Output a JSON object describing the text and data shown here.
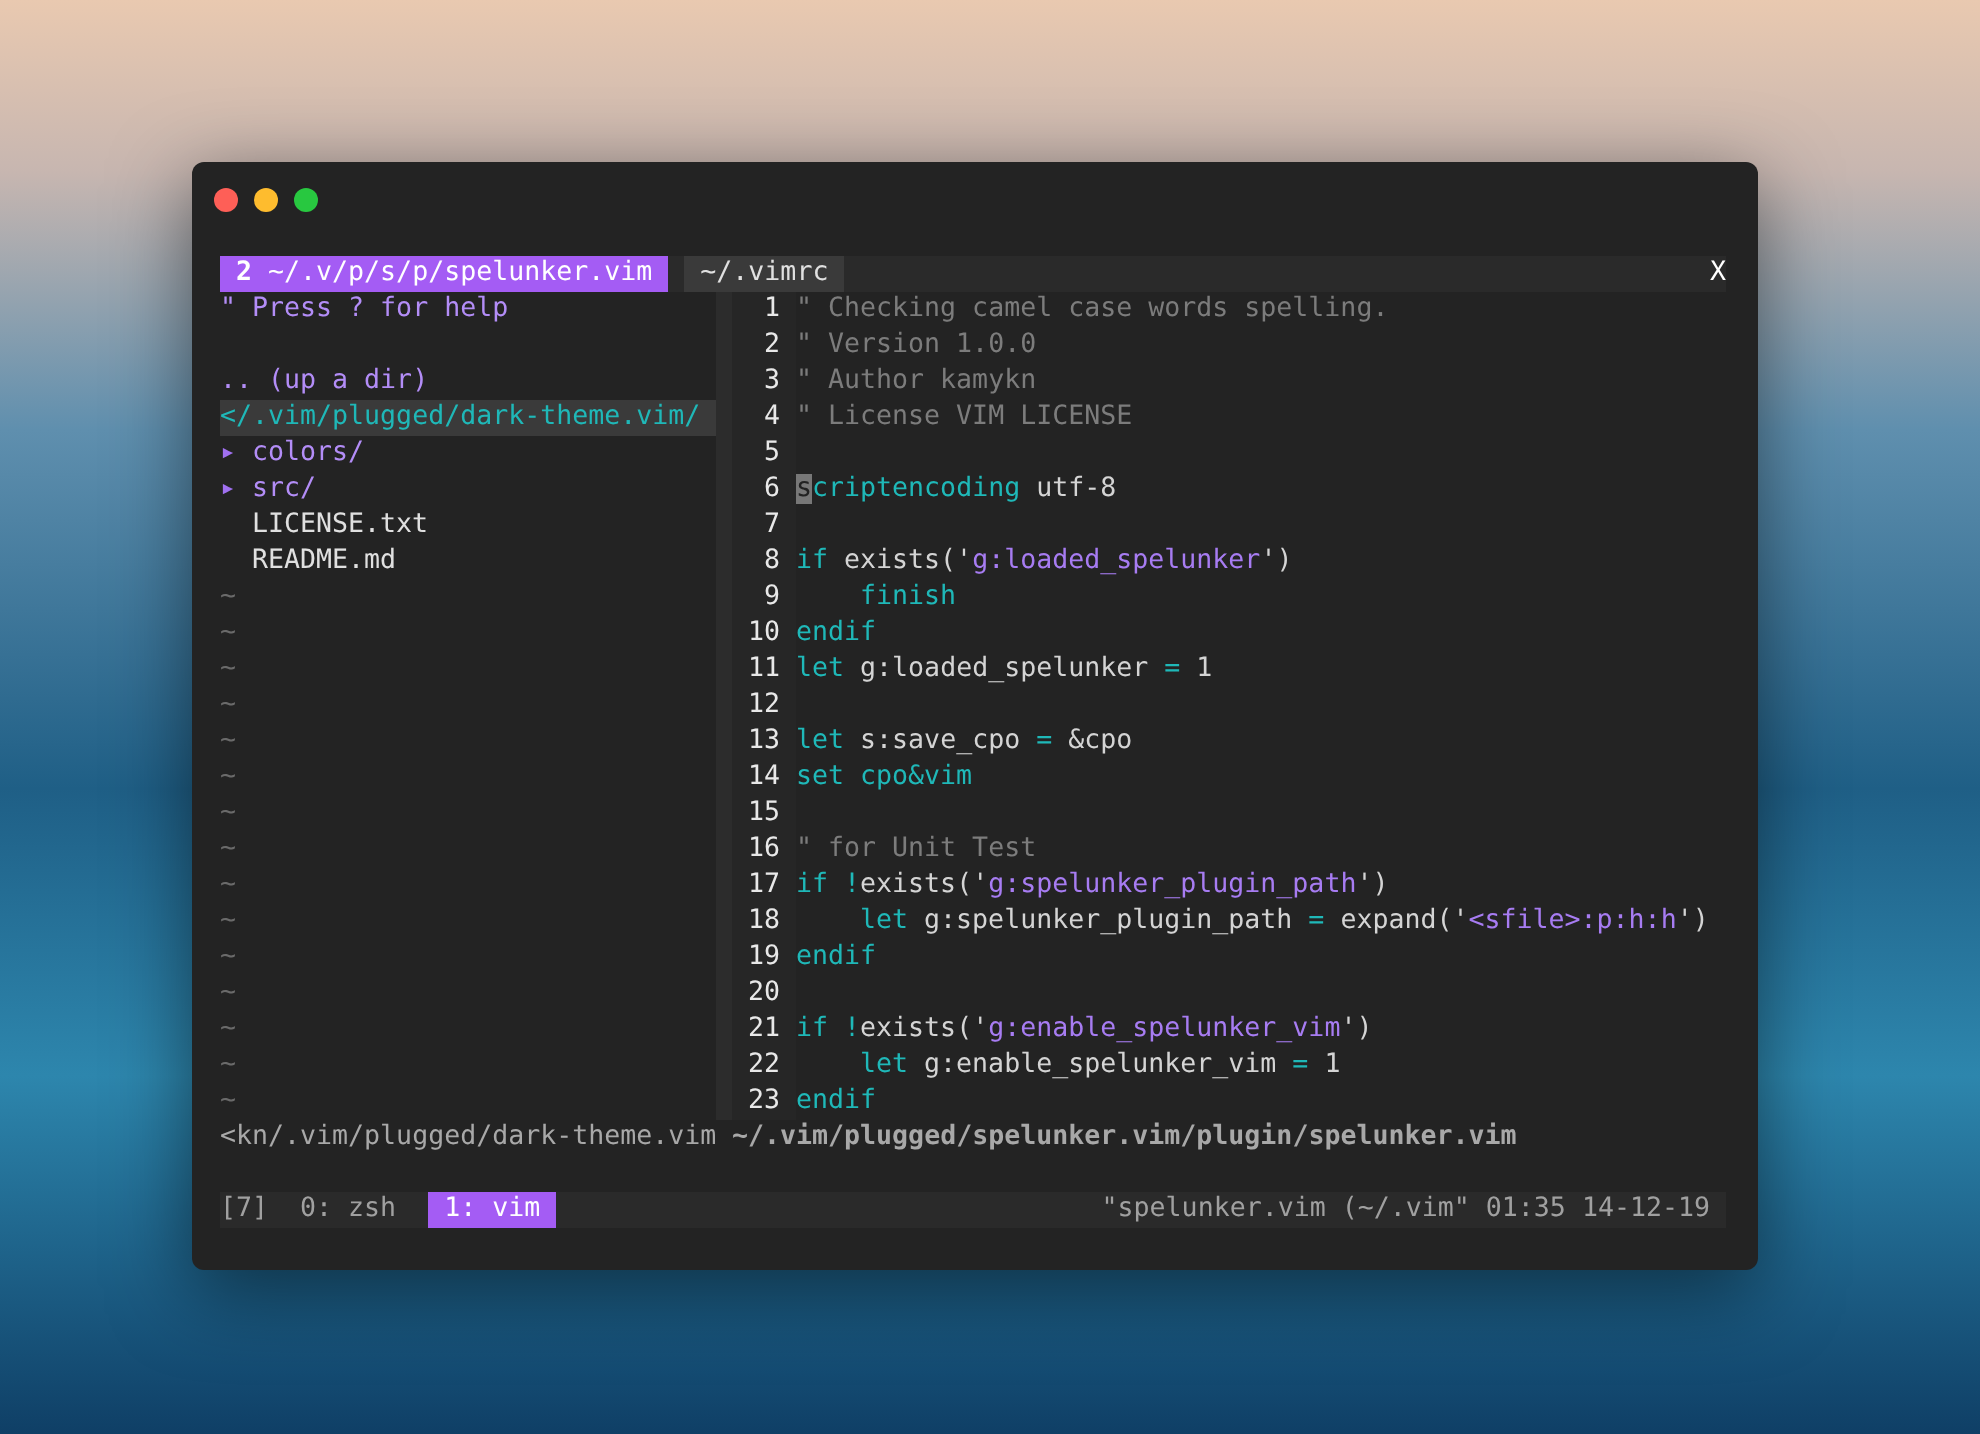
{
  "tabline": {
    "tabs": [
      {
        "count": "2",
        "label": "~/.v/p/s/p/spelunker.vim",
        "selected": true
      },
      {
        "label": "~/.vimrc",
        "selected": false
      }
    ],
    "close": "X"
  },
  "tree": {
    "help": "\" Press ? for help",
    "items": [
      {
        "kind": "up",
        "label": ".. (up a dir)",
        "selected": false
      },
      {
        "kind": "root",
        "label": "</.vim/plugged/dark-theme.vim/",
        "selected": true
      },
      {
        "kind": "dir",
        "marker": "▸",
        "label": "colors/",
        "selected": false
      },
      {
        "kind": "dir",
        "marker": "▸",
        "label": "src/",
        "selected": false
      },
      {
        "kind": "file",
        "label": "LICENSE.txt",
        "selected": false
      },
      {
        "kind": "file",
        "label": "README.md",
        "selected": false
      }
    ],
    "filler": [
      "~",
      "~",
      "~",
      "~",
      "~",
      "~",
      "~",
      "~",
      "~",
      "~",
      "~",
      "~",
      "~",
      "~",
      "~"
    ]
  },
  "editor": {
    "lines": [
      {
        "number": "1",
        "tokens": [
          {
            "kind": "comment",
            "text": "\" Checking camel case words spelling."
          }
        ]
      },
      {
        "number": "2",
        "tokens": [
          {
            "kind": "comment",
            "text": "\" Version 1.0.0"
          }
        ]
      },
      {
        "number": "3",
        "tokens": [
          {
            "kind": "comment",
            "text": "\" Author kamykn"
          }
        ]
      },
      {
        "number": "4",
        "tokens": [
          {
            "kind": "comment",
            "text": "\" License VIM LICENSE"
          }
        ]
      },
      {
        "number": "5"
      },
      {
        "number": "6",
        "tokens": [
          {
            "kind": "cursor",
            "text": "s"
          },
          {
            "kind": "keyword",
            "text": "criptencoding"
          },
          {
            "kind": "plain",
            "text": " utf-8"
          }
        ]
      },
      {
        "number": "7"
      },
      {
        "number": "8",
        "tokens": [
          {
            "kind": "keyword",
            "text": "if"
          },
          {
            "kind": "plain",
            "text": " exists('"
          },
          {
            "kind": "string",
            "text": "g:loaded_spelunker"
          },
          {
            "kind": "plain",
            "text": "')"
          }
        ]
      },
      {
        "number": "9",
        "indented": true,
        "tokens": [
          {
            "kind": "keyword",
            "text": "finish"
          }
        ]
      },
      {
        "number": "10",
        "tokens": [
          {
            "kind": "keyword",
            "text": "endif"
          }
        ]
      },
      {
        "number": "11",
        "tokens": [
          {
            "kind": "keyword",
            "text": "let"
          },
          {
            "kind": "plain",
            "text": " g:loaded_spelunker "
          },
          {
            "kind": "operator",
            "text": "="
          },
          {
            "kind": "plain",
            "text": " 1"
          }
        ]
      },
      {
        "number": "12"
      },
      {
        "number": "13",
        "tokens": [
          {
            "kind": "keyword",
            "text": "let"
          },
          {
            "kind": "plain",
            "text": " s:save_cpo "
          },
          {
            "kind": "operator",
            "text": "="
          },
          {
            "kind": "plain",
            "text": " &cpo"
          }
        ]
      },
      {
        "number": "14",
        "tokens": [
          {
            "kind": "keyword",
            "text": "set cpo&vim"
          }
        ]
      },
      {
        "number": "15"
      },
      {
        "number": "16",
        "tokens": [
          {
            "kind": "comment",
            "text": "\" for Unit Test"
          }
        ]
      },
      {
        "number": "17",
        "tokens": [
          {
            "kind": "keyword",
            "text": "if"
          },
          {
            "kind": "operator",
            "text": " !"
          },
          {
            "kind": "plain",
            "text": "exists('"
          },
          {
            "kind": "string",
            "text": "g:spelunker_plugin_path"
          },
          {
            "kind": "plain",
            "text": "')"
          }
        ]
      },
      {
        "number": "18",
        "indented": true,
        "tokens": [
          {
            "kind": "keyword",
            "text": "let"
          },
          {
            "kind": "plain",
            "text": " g:spelunker_plugin_path "
          },
          {
            "kind": "operator",
            "text": "="
          },
          {
            "kind": "plain",
            "text": " expand('"
          },
          {
            "kind": "string",
            "text": "<sfile>:p:h:h"
          },
          {
            "kind": "plain",
            "text": "')"
          }
        ]
      },
      {
        "number": "19",
        "tokens": [
          {
            "kind": "keyword",
            "text": "endif"
          }
        ]
      },
      {
        "number": "20"
      },
      {
        "number": "21",
        "tokens": [
          {
            "kind": "keyword",
            "text": "if"
          },
          {
            "kind": "operator",
            "text": " !"
          },
          {
            "kind": "plain",
            "text": "exists('"
          },
          {
            "kind": "string",
            "text": "g:enable_spelunker_vim"
          },
          {
            "kind": "plain",
            "text": "')"
          }
        ]
      },
      {
        "number": "22",
        "indented": true,
        "tokens": [
          {
            "kind": "keyword",
            "text": "let"
          },
          {
            "kind": "plain",
            "text": " g:enable_spelunker_vim "
          },
          {
            "kind": "operator",
            "text": "="
          },
          {
            "kind": "plain",
            "text": " 1"
          }
        ]
      },
      {
        "number": "23",
        "tokens": [
          {
            "kind": "keyword",
            "text": "endif"
          }
        ]
      }
    ]
  },
  "statusline": {
    "left": "<kn/.vim/plugged/dark-theme.vim",
    "right": "~/.vim/plugged/spelunker.vim/plugin/spelunker.vim"
  },
  "tmux": {
    "session": "[7]",
    "windows": [
      {
        "label": "0: zsh",
        "selected": false
      },
      {
        "label": "1: vim",
        "selected": true
      }
    ],
    "status": "\"spelunker.vim (~/.vim\" 01:35 14-12-19"
  }
}
